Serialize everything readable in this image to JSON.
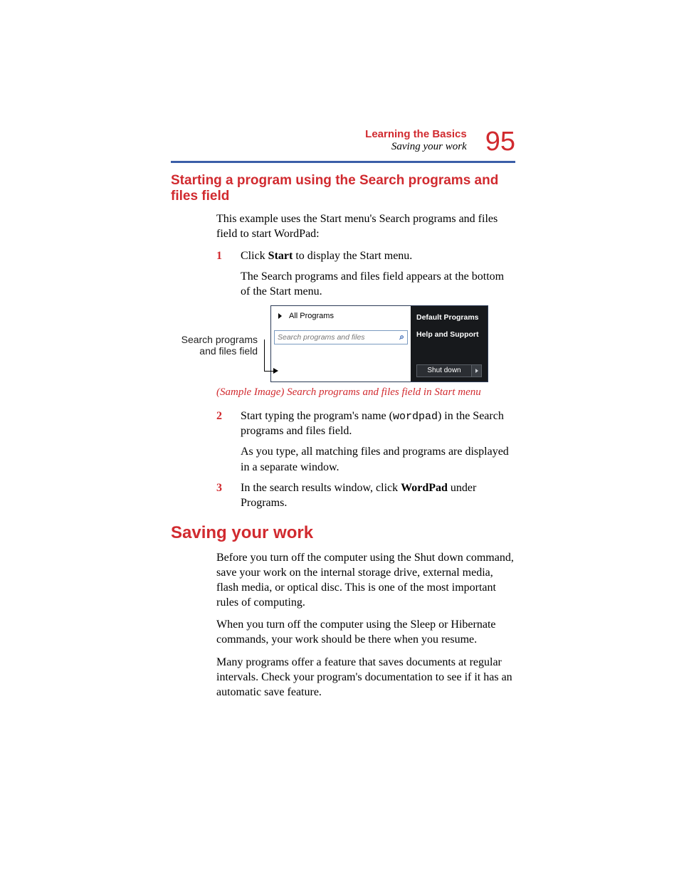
{
  "header": {
    "chapter": "Learning the Basics",
    "section": "Saving your work",
    "page_number": "95"
  },
  "h2": "Starting a program using the Search programs and files field",
  "intro": "This example uses the Start menu's Search programs and files field to start WordPad:",
  "steps_a": [
    {
      "n": "1",
      "lines": [
        "Click <b>Start</b> to display the Start menu.",
        "The Search programs and files field appears at the bottom of the Start menu."
      ]
    }
  ],
  "callout_label": "Search programs and files field",
  "start_menu": {
    "all_programs": "All Programs",
    "search_placeholder": "Search programs and files",
    "right_items": [
      "Default Programs",
      "Help and Support"
    ],
    "shutdown": "Shut down"
  },
  "caption": "(Sample Image) Search programs and files field in Start menu",
  "steps_b": [
    {
      "n": "2",
      "lines": [
        "Start typing the program's name (<span class=\"mono\">wordpad</span>) in the Search programs and files field.",
        "As you type, all matching files and programs are displayed in a separate window."
      ]
    },
    {
      "n": "3",
      "lines": [
        "In the search results window, click <b>WordPad</b> under Programs."
      ]
    }
  ],
  "h1": "Saving your work",
  "paras": [
    "Before you turn off the computer using the Shut down command, save your work on the internal storage drive, external media, flash media, or optical disc. This is one of the most important rules of computing.",
    "When you turn off the computer using the Sleep or Hibernate commands, your work should be there when you resume.",
    "Many programs offer a feature that saves documents at regular intervals. Check your program's documentation to see if it has an automatic save feature."
  ]
}
